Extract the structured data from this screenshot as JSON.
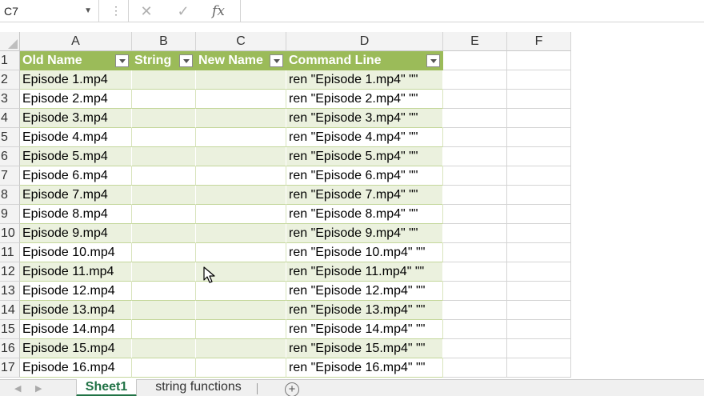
{
  "formula_bar": {
    "name_box": "C7",
    "name_box_dropdown_icon": "chevron-down-icon",
    "cancel_icon": "cancel-x-icon",
    "enter_icon": "checkmark-icon",
    "function_icon": "fx",
    "formula": ""
  },
  "columns": [
    "A",
    "B",
    "C",
    "D",
    "E",
    "F"
  ],
  "table": {
    "headers": [
      "Old Name",
      "String",
      "New Name",
      "Command Line"
    ],
    "header_color": "#9bbb59",
    "band_color": "#ebf1de",
    "rows": [
      {
        "row": "2",
        "a": "Episode 1.mp4",
        "b": "",
        "c": "",
        "d": "ren \"Episode 1.mp4\" \"\""
      },
      {
        "row": "3",
        "a": "Episode 2.mp4",
        "b": "",
        "c": "",
        "d": "ren \"Episode 2.mp4\" \"\""
      },
      {
        "row": "4",
        "a": "Episode 3.mp4",
        "b": "",
        "c": "",
        "d": "ren \"Episode 3.mp4\" \"\""
      },
      {
        "row": "5",
        "a": "Episode 4.mp4",
        "b": "",
        "c": "",
        "d": "ren \"Episode 4.mp4\" \"\""
      },
      {
        "row": "6",
        "a": "Episode 5.mp4",
        "b": "",
        "c": "",
        "d": "ren \"Episode 5.mp4\" \"\""
      },
      {
        "row": "7",
        "a": "Episode 6.mp4",
        "b": "",
        "c": "",
        "d": "ren \"Episode 6.mp4\" \"\""
      },
      {
        "row": "8",
        "a": "Episode 7.mp4",
        "b": "",
        "c": "",
        "d": "ren \"Episode 7.mp4\" \"\""
      },
      {
        "row": "9",
        "a": "Episode 8.mp4",
        "b": "",
        "c": "",
        "d": "ren \"Episode 8.mp4\" \"\""
      },
      {
        "row": "10",
        "a": "Episode 9.mp4",
        "b": "",
        "c": "",
        "d": "ren \"Episode 9.mp4\" \"\""
      },
      {
        "row": "11",
        "a": "Episode 10.mp4",
        "b": "",
        "c": "",
        "d": "ren \"Episode 10.mp4\" \"\""
      },
      {
        "row": "12",
        "a": "Episode 11.mp4",
        "b": "",
        "c": "",
        "d": "ren \"Episode 11.mp4\" \"\""
      },
      {
        "row": "13",
        "a": "Episode 12.mp4",
        "b": "",
        "c": "",
        "d": "ren \"Episode 12.mp4\" \"\""
      },
      {
        "row": "14",
        "a": "Episode 13.mp4",
        "b": "",
        "c": "",
        "d": "ren \"Episode 13.mp4\" \"\""
      },
      {
        "row": "15",
        "a": "Episode 14.mp4",
        "b": "",
        "c": "",
        "d": "ren \"Episode 14.mp4\" \"\""
      },
      {
        "row": "16",
        "a": "Episode 15.mp4",
        "b": "",
        "c": "",
        "d": "ren \"Episode 15.mp4\" \"\""
      },
      {
        "row": "17",
        "a": "Episode 16.mp4",
        "b": "",
        "c": "",
        "d": "ren \"Episode 16.mp4\" \"\""
      }
    ]
  },
  "sheet_tabs": {
    "tabs": [
      {
        "label": "Sheet1",
        "active": true
      },
      {
        "label": "string functions",
        "active": false
      }
    ],
    "add_sheet_icon": "plus-circle-icon",
    "accent_color": "#217346"
  }
}
